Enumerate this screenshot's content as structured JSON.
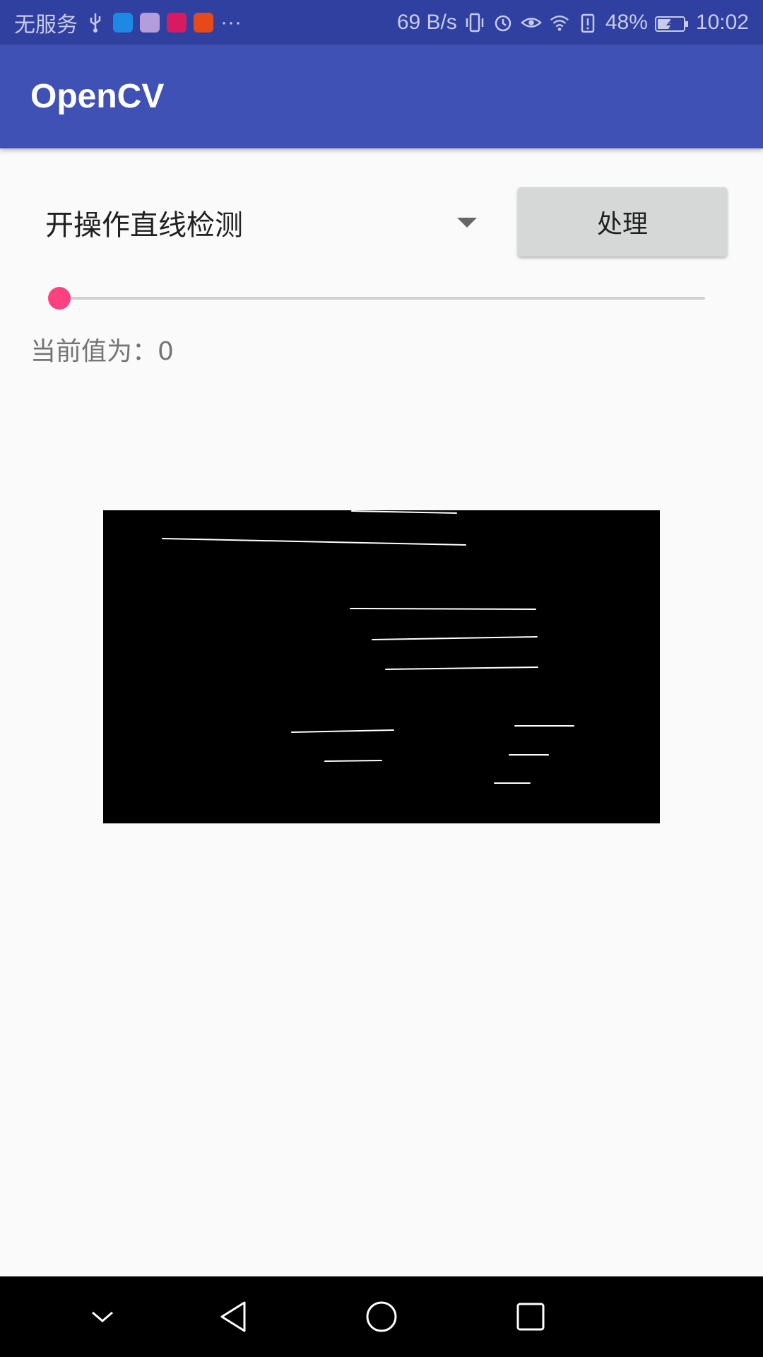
{
  "status_bar": {
    "carrier": "无服务",
    "overflow": "···",
    "net_speed": "69 B/s",
    "battery_percent": "48%",
    "time": "10:02",
    "app_icons": [
      {
        "name": "browser-app-icon",
        "color": "#1e88e5"
      },
      {
        "name": "gallery-app-icon",
        "color": "#b39ddb"
      },
      {
        "name": "huawei-app-icon",
        "color": "#d81b60"
      },
      {
        "name": "video-app-icon",
        "color": "#e64a19"
      }
    ]
  },
  "toolbar": {
    "title": "OpenCV"
  },
  "controls": {
    "spinner_selected": "开操作直线检测",
    "process_button": "处理",
    "seekbar_value": 0,
    "value_label": "当前值为：0"
  },
  "nav_bar": {
    "icons": [
      "chevron-down-icon",
      "back-icon",
      "home-icon",
      "recents-icon"
    ]
  },
  "colors": {
    "status_bar": "#3040a0",
    "toolbar": "#3f51b5",
    "accent": "#ff4081",
    "button": "#d6d7d7",
    "background": "#fafafa"
  }
}
